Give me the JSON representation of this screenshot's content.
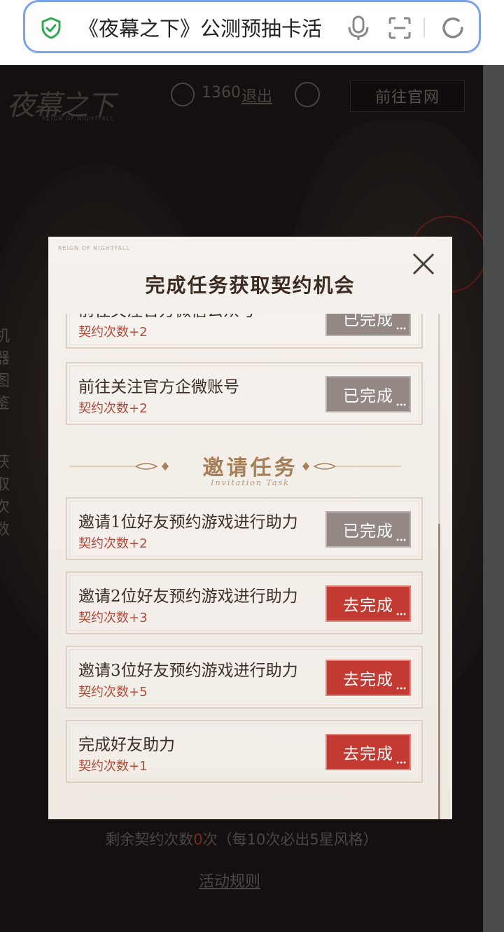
{
  "browser": {
    "url_title": "《夜幕之下》公测预抽卡活"
  },
  "page": {
    "logo": "夜幕之下",
    "logo_sub": "REIGN OF NIGHTFALL",
    "user_count": "1360",
    "logout_label": "退出",
    "official_site_label": "前往官网",
    "side_text_1": "机器图鉴",
    "side_text_2": "获取次数",
    "remain_prefix": "剩余契约次数",
    "remain_count": "0",
    "remain_suffix": "次（每10次必出5星风格）",
    "rules_label": "活动规则"
  },
  "modal": {
    "tag": "REIGN OF NIGHTFALL",
    "title": "完成任务获取契约机会",
    "section_title": "邀请任务",
    "section_sub": "Invitation Task",
    "tasks_top": [
      {
        "name": "前往关注官方微信公众号",
        "reward": "契约次数+2",
        "button": "已完成",
        "status": "done"
      },
      {
        "name": "前往关注官方企微账号",
        "reward": "契约次数+2",
        "button": "已完成",
        "status": "done"
      }
    ],
    "tasks_invite": [
      {
        "name": "邀请1位好友预约游戏进行助力",
        "reward": "契约次数+2",
        "button": "已完成",
        "status": "done"
      },
      {
        "name": "邀请2位好友预约游戏进行助力",
        "reward": "契约次数+3",
        "button": "去完成",
        "status": "todo"
      },
      {
        "name": "邀请3位好友预约游戏进行助力",
        "reward": "契约次数+5",
        "button": "去完成",
        "status": "todo"
      },
      {
        "name": "完成好友助力",
        "reward": "契约次数+1",
        "button": "去完成",
        "status": "todo"
      }
    ]
  },
  "colors": {
    "accent_red": "#c23a31",
    "done_gray": "#938884",
    "reward_red": "#b04a3b"
  }
}
